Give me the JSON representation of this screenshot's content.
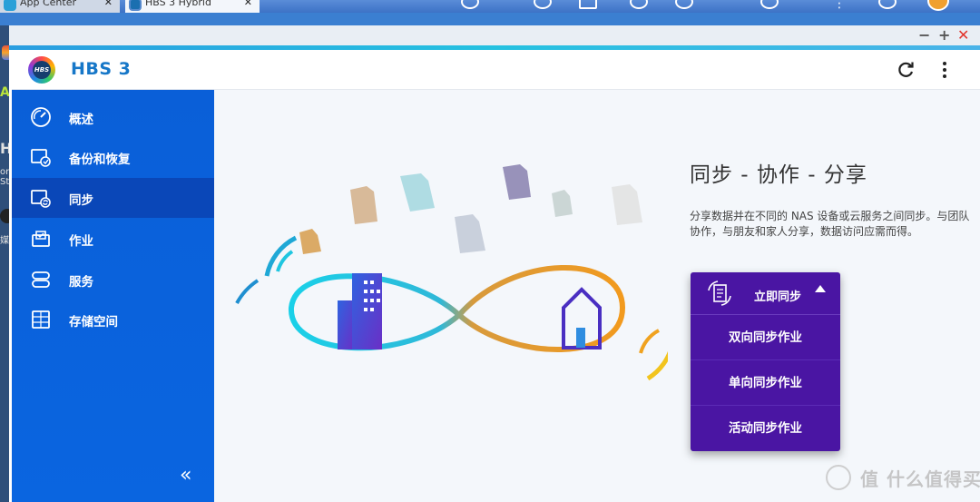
{
  "os": {
    "tab1_label": "App Center",
    "tab2_label": "HBS 3 Hybrid"
  },
  "behind": {
    "ap": "AP",
    "h": "H",
    "stor": "oric",
    "stat": "Stat",
    "media": "媒体"
  },
  "window": {
    "min": "−",
    "max": "+",
    "close": "✕"
  },
  "header": {
    "logo_text": "HBS",
    "title": "HBS 3",
    "refresh_icon": "refresh-icon",
    "more_icon": "more-vertical-icon"
  },
  "sidebar": {
    "items": [
      {
        "label": "概述",
        "icon": "dashboard-icon"
      },
      {
        "label": "备份和恢复",
        "icon": "backup-restore-icon"
      },
      {
        "label": "同步",
        "icon": "sync-icon",
        "active": true
      },
      {
        "label": "作业",
        "icon": "jobs-icon"
      },
      {
        "label": "服务",
        "icon": "services-icon"
      },
      {
        "label": "存储空间",
        "icon": "storage-icon"
      }
    ],
    "collapse_label": "«"
  },
  "main": {
    "heading": "同步 - 协作 - 分享",
    "description": "分享数据并在不同的 NAS 设备或云服务之间同步。与团队协作，与朋友和家人分享，数据访问应需而得。",
    "sync_now_label": "立即同步",
    "sync_menu": [
      {
        "label": "双向同步作业"
      },
      {
        "label": "单向同步作业"
      },
      {
        "label": "活动同步作业"
      }
    ]
  },
  "watermark": "值 什么值得买",
  "colors": {
    "sidebar_bg": "#0a5fd8",
    "sidebar_active": "#0a47b8",
    "accent_title": "#1677c8",
    "dropdown_bg": "#4a15a3"
  }
}
